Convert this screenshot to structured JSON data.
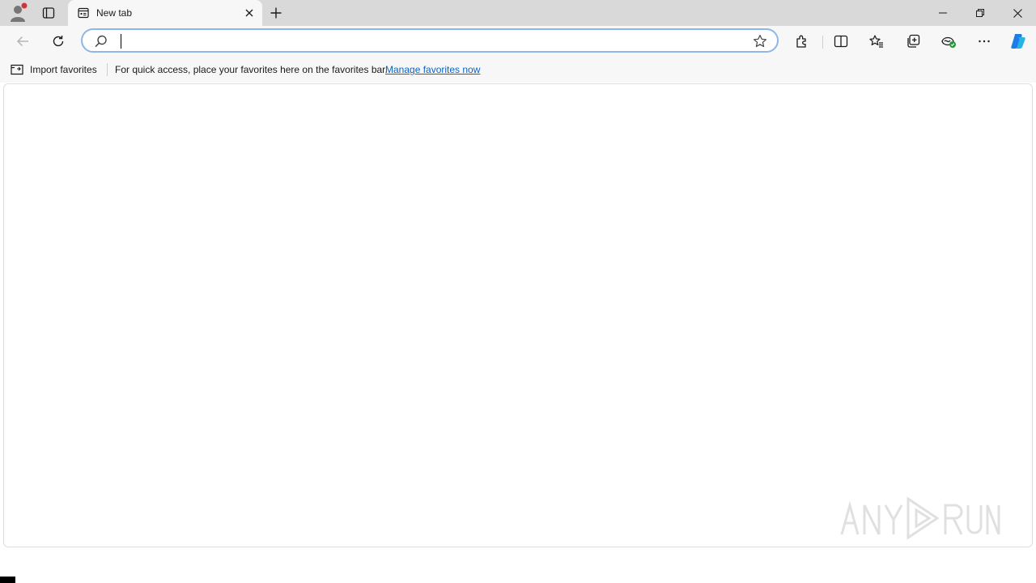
{
  "browser": {
    "tab": {
      "title": "New tab",
      "icon": "new-tab-page-icon"
    },
    "window_controls": [
      "minimize-icon",
      "restore-icon",
      "close-icon"
    ],
    "address_bar": {
      "value": "",
      "placeholder": ""
    },
    "toolbar_icons": [
      "back-icon",
      "refresh-icon",
      "extensions-icon",
      "split-screen-icon",
      "favorites-icon",
      "collections-icon",
      "browser-essentials-icon",
      "more-icon",
      "copilot-icon"
    ]
  },
  "favorites_bar": {
    "import_label": "Import favorites",
    "message": "For quick access, place your favorites here on the favorites bar.",
    "link": "Manage favorites now"
  },
  "watermark": {
    "text": "ANY RUN"
  },
  "colors": {
    "titlebar": "#d9d9d9",
    "toolbar": "#f7f7f7",
    "link": "#0b63c5",
    "address_border": "#8fb6e8",
    "copilot_blue": "#1f7be6",
    "profile_badge": "#d13438"
  }
}
